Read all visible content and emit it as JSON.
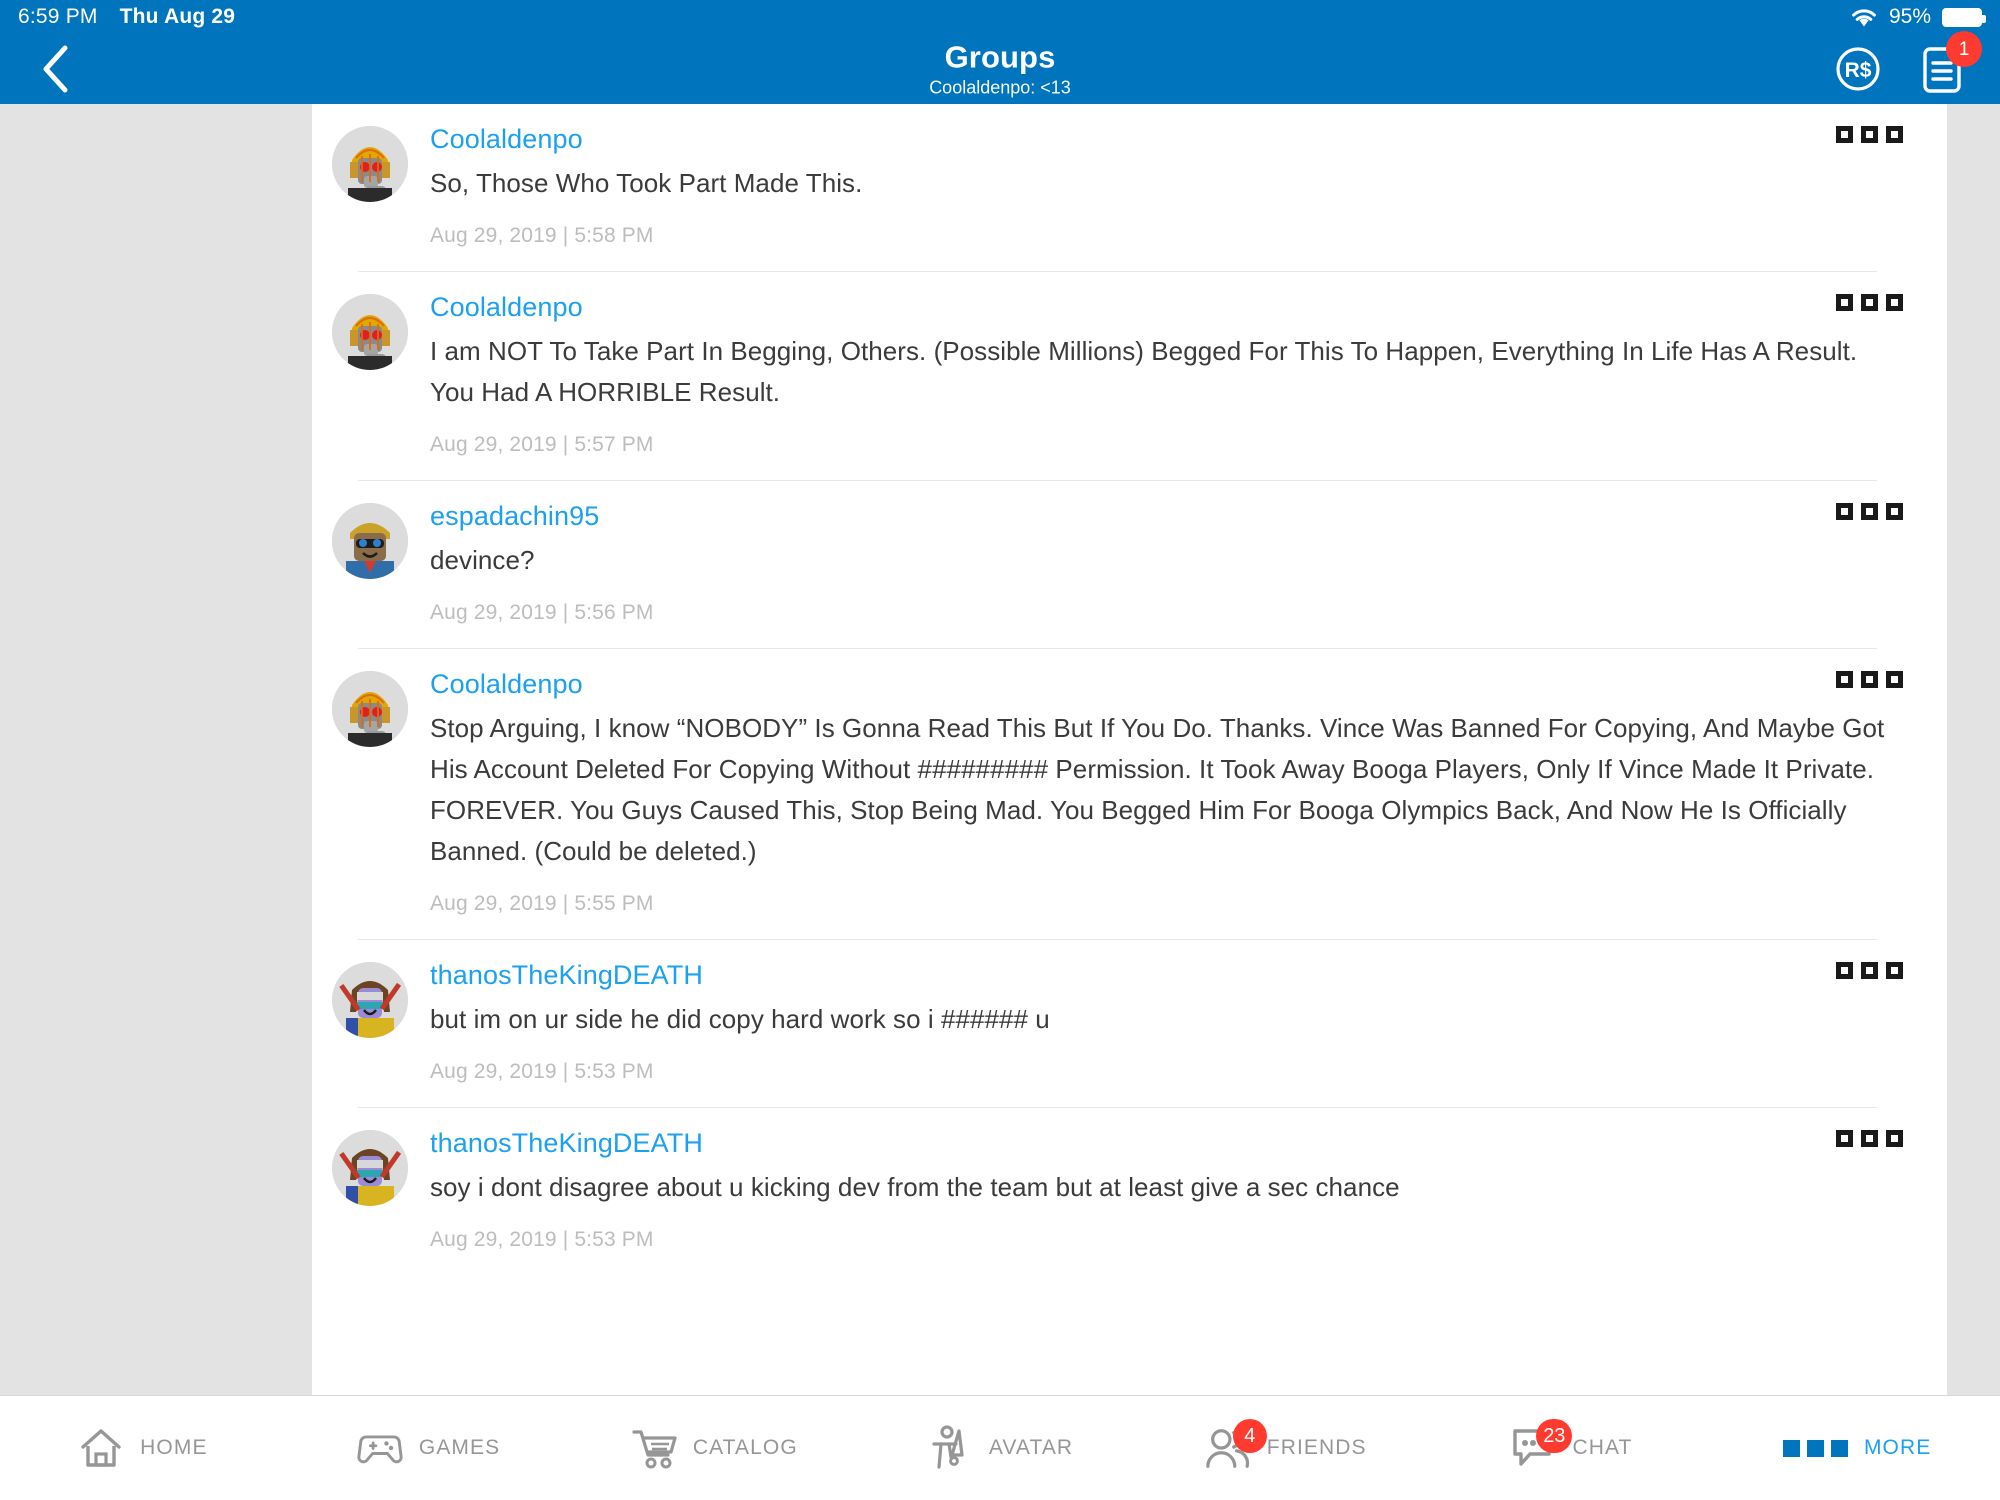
{
  "statusbar": {
    "time": "6:59 PM",
    "date": "Thu Aug 29",
    "battery_percent": "95%",
    "wifi_icon": "wifi-icon",
    "battery_icon": "battery-icon"
  },
  "header": {
    "back_icon": "back-chevron-icon",
    "title": "Groups",
    "subtitle": "Coolaldenpo: <13",
    "robux_icon": "robux-icon",
    "robux_label": "R$",
    "notifications_icon": "document-notifications-icon",
    "notifications_badge": "1",
    "bg_color": "#0074BC"
  },
  "posts": [
    {
      "username": "Coolaldenpo",
      "text": "So, Those Who Took Part Made This.",
      "timestamp": "Aug 29, 2019 | 5:58 PM",
      "menu_icon": "post-options-icon",
      "avatar_name": "avatar-coolaldenpo"
    },
    {
      "username": "Coolaldenpo",
      "text": "I am NOT To Take Part In Begging, Others. (Possible Millions) Begged For This To Happen, Everything In Life Has A Result. You Had A HORRIBLE Result.",
      "timestamp": "Aug 29, 2019 | 5:57 PM",
      "menu_icon": "post-options-icon",
      "avatar_name": "avatar-coolaldenpo"
    },
    {
      "username": "espadachin95",
      "text": "devince?",
      "timestamp": "Aug 29, 2019 | 5:56 PM",
      "menu_icon": "post-options-icon",
      "avatar_name": "avatar-espadachin95"
    },
    {
      "username": "Coolaldenpo",
      "text": "Stop Arguing, I know “NOBODY” Is Gonna Read This But If You Do. Thanks. Vince Was Banned For Copying, And Maybe Got His Account Deleted For Copying Without ######### Permission. It Took Away Booga Players, Only If Vince Made It Private. FOREVER. You Guys Caused This, Stop Being Mad. You Begged Him For Booga Olympics Back, And Now He Is Officially Banned. (Could be deleted.)",
      "timestamp": "Aug 29, 2019 | 5:55 PM",
      "menu_icon": "post-options-icon",
      "avatar_name": "avatar-coolaldenpo"
    },
    {
      "username": "thanosTheKingDEATH",
      "text": "but im on ur side he did copy hard work so i ###### u",
      "timestamp": "Aug 29, 2019 | 5:53 PM",
      "menu_icon": "post-options-icon",
      "avatar_name": "avatar-thanostheking"
    },
    {
      "username": "thanosTheKingDEATH",
      "text": "soy i dont disagree about u kicking dev from the team but at least give a sec chance",
      "timestamp": "Aug 29, 2019 | 5:53 PM",
      "menu_icon": "post-options-icon",
      "avatar_name": "avatar-thanostheking"
    }
  ],
  "bottomnav": {
    "items": [
      {
        "label": "HOME",
        "icon": "home-icon",
        "badge": "",
        "active": false
      },
      {
        "label": "GAMES",
        "icon": "gamepad-icon",
        "badge": "",
        "active": false
      },
      {
        "label": "CATALOG",
        "icon": "cart-icon",
        "badge": "",
        "active": false
      },
      {
        "label": "AVATAR",
        "icon": "avatar-icon",
        "badge": "",
        "active": false
      },
      {
        "label": "FRIENDS",
        "icon": "friends-icon",
        "badge": "4",
        "active": false
      },
      {
        "label": "CHAT",
        "icon": "chat-icon",
        "badge": "23",
        "active": false
      },
      {
        "label": "MORE",
        "icon": "more-squares-icon",
        "badge": "",
        "active": true
      }
    ]
  },
  "colors": {
    "brand_blue": "#0074BC",
    "link_blue": "#1CA0F0",
    "badge_red": "#FF3B30",
    "page_gray": "#E3E3E3",
    "text_gray": "#3B3B3B",
    "muted_gray": "#BDBDBD"
  }
}
